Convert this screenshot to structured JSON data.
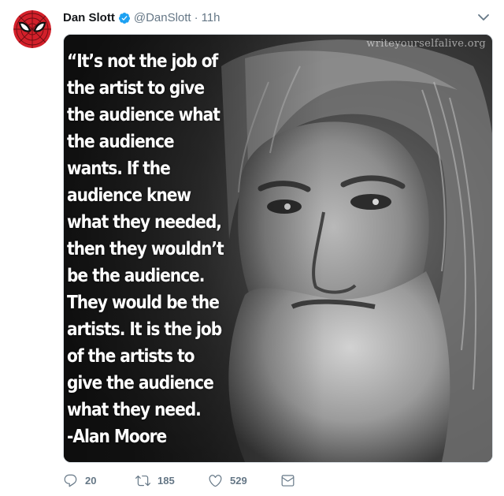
{
  "tweet": {
    "display_name": "Dan Slott",
    "handle": "@DanSlott",
    "separator": "·",
    "time": "11h",
    "verified": true,
    "avatar_icon": "spider-man-mask-icon",
    "media": {
      "watermark": "writeyourselfalive.org",
      "quote_lines": [
        "“It’s not the job of",
        "the artist to give",
        "the audience what",
        "the audience",
        "wants. If the",
        "audience knew",
        "what they needed,",
        "then they wouldn’t",
        "be the audience.",
        "They would be the",
        "artists. It is the job",
        "of the artists to",
        "give the audience",
        "what they need.",
        "-Alan Moore"
      ]
    },
    "actions": {
      "reply_count": "20",
      "retweet_count": "185",
      "like_count": "529"
    }
  },
  "colors": {
    "name": "#14171a",
    "secondary": "#657786",
    "verified": "#1da1f2",
    "avatar_red": "#d3202a"
  }
}
